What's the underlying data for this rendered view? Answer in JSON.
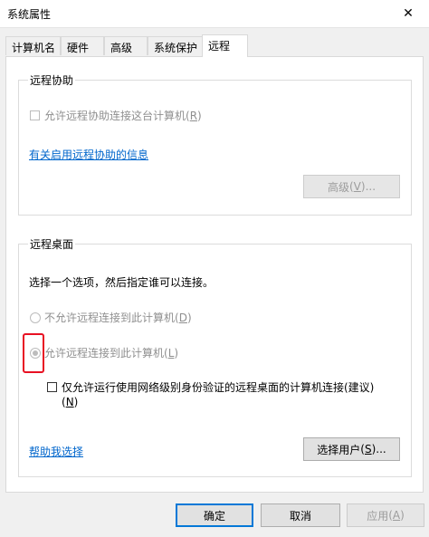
{
  "window": {
    "title": "系统属性",
    "close_glyph": "✕"
  },
  "tabs": [
    {
      "label": "计算机名",
      "active": false
    },
    {
      "label": "硬件",
      "active": false
    },
    {
      "label": "高级",
      "active": false
    },
    {
      "label": "系统保护",
      "active": false
    },
    {
      "label": "远程",
      "active": true
    }
  ],
  "remote_assistance": {
    "group_title": "远程协助",
    "allow_checkbox_text": "允许远程协助连接这台计算机",
    "allow_checkbox_key": "R",
    "info_link": "有关启用远程协助的信息",
    "advanced_button_text": "高级",
    "advanced_button_key": "V",
    "advanced_button_suffix": "..."
  },
  "remote_desktop": {
    "group_title": "远程桌面",
    "instruction": "选择一个选项，然后指定谁可以连接。",
    "radio_deny_text": "不允许远程连接到此计算机",
    "radio_deny_key": "D",
    "radio_allow_text": "允许远程连接到此计算机",
    "radio_allow_key": "L",
    "nla_text_line1": "仅允许运行使用网络级别身份验证的远程桌面的计算机连接(建议)",
    "nla_key": "N",
    "help_link": "帮助我选择",
    "select_users_text": "选择用户",
    "select_users_key": "S",
    "select_users_suffix": "..."
  },
  "footer": {
    "ok": "确定",
    "cancel": "取消",
    "apply": "应用",
    "apply_key": "A"
  },
  "colors": {
    "link": "#0066cc",
    "highlight": "#e81123",
    "default_button": "#0078d7"
  }
}
